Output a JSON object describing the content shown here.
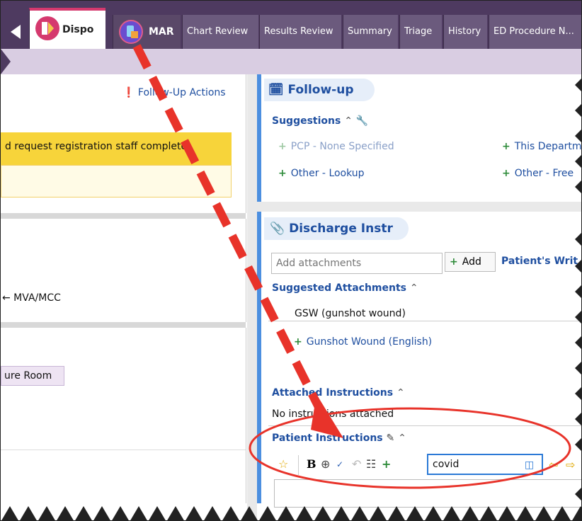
{
  "tabs": [
    {
      "label": "Dispo",
      "active": true
    },
    {
      "label": "MAR"
    },
    {
      "label": "Chart Review"
    },
    {
      "label": "Results Review"
    },
    {
      "label": "Summary"
    },
    {
      "label": "Triage"
    },
    {
      "label": "History"
    },
    {
      "label": "ED Procedure N..."
    }
  ],
  "left": {
    "followup_actions": "Follow-Up Actions",
    "alert_text": "d request registration staff complete",
    "reason_text": "← MVA/MCC",
    "room_badge": "ure Room"
  },
  "followup": {
    "title": "Follow-up",
    "suggestions_label": "Suggestions",
    "items": [
      "PCP - None Specified",
      "This Departm",
      "Other - Lookup",
      "Other - Free"
    ]
  },
  "discharge": {
    "title": "Discharge Instr",
    "attachments_placeholder": "Add attachments",
    "add_label": "Add",
    "patients_writ": "Patient's Writ",
    "suggested_label": "Suggested Attachments",
    "category": "GSW (gunshot wound)",
    "suggested_item": "Gunshot Wound (English)",
    "attached_label": "Attached Instructions",
    "no_instructions": "No instructions attached",
    "patient_instructions_label": "Patient Instructions",
    "search_value": "covid"
  },
  "colors": {
    "tab_bg": "#4e3a60",
    "accent": "#d5396e",
    "link": "#1f4fa0",
    "callout_red": "#e8332a"
  }
}
